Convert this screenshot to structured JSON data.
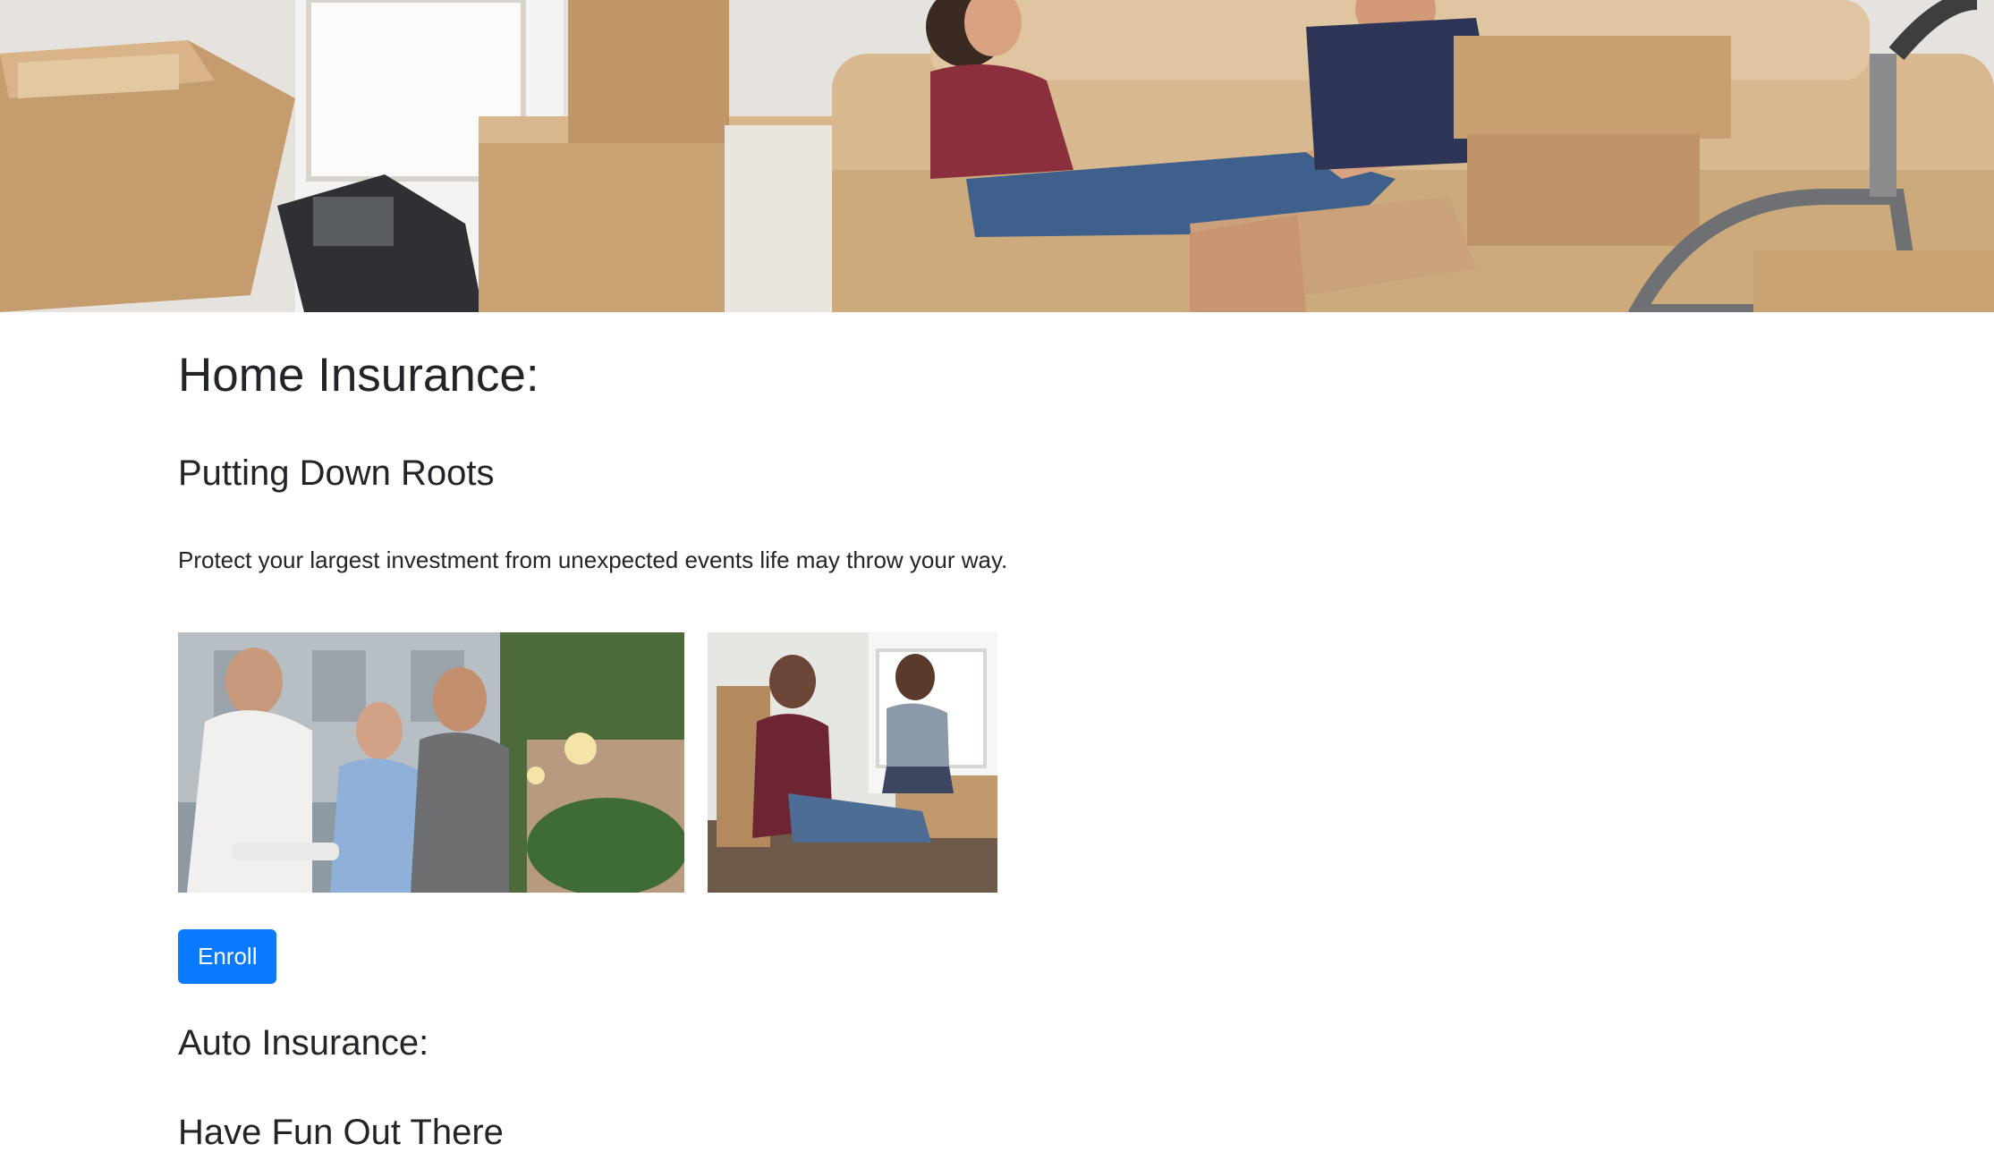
{
  "hero": {
    "image": "couple-on-sofa-moving-boxes-photo"
  },
  "home": {
    "title": "Home Insurance:",
    "subtitle": "Putting Down Roots",
    "description": "Protect your largest investment from unexpected events life may throw your way.",
    "photos": [
      "friends-barbecue-photo",
      "couple-moving-in-photo"
    ],
    "enroll_label": "Enroll"
  },
  "auto": {
    "title": "Auto Insurance:",
    "subtitle": "Have Fun Out There"
  },
  "colors": {
    "button": "#0a7bff",
    "text": "#212529"
  }
}
